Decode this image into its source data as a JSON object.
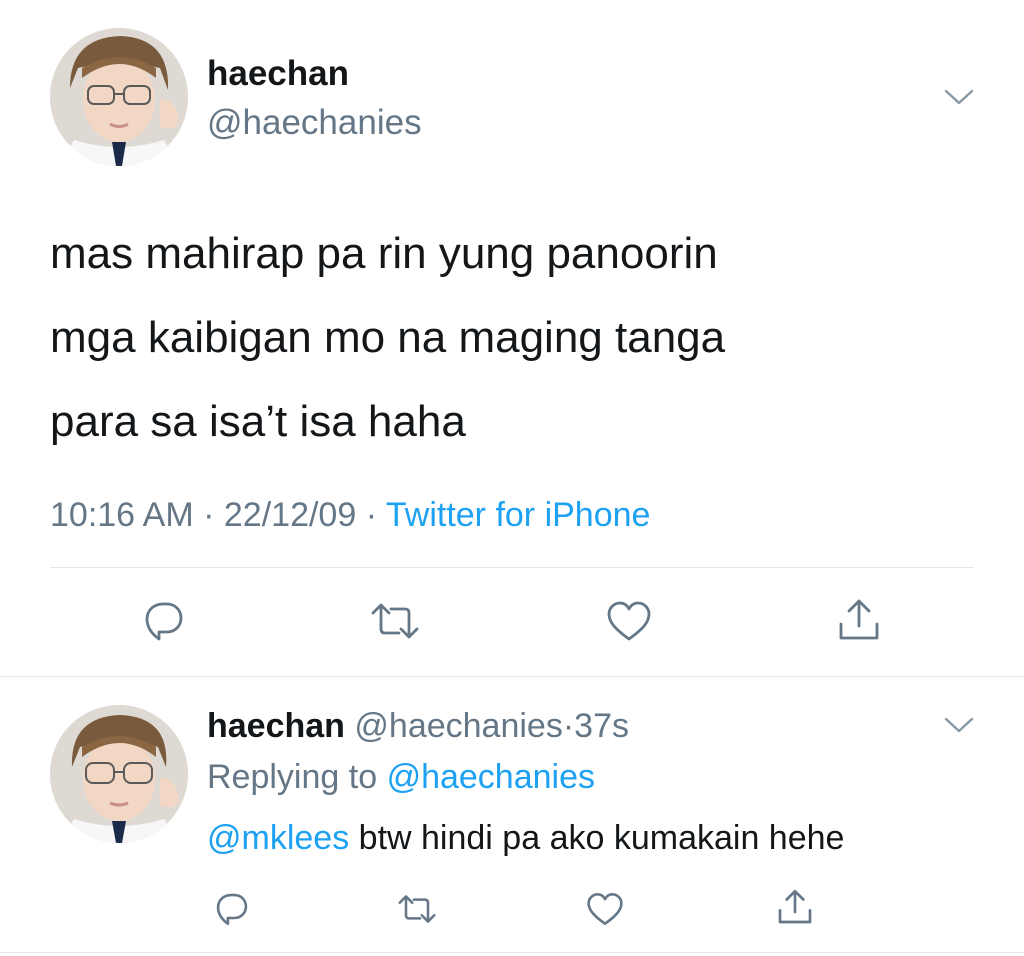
{
  "main_tweet": {
    "name": "haechan",
    "handle": "@haechanies",
    "text_lines": [
      "mas mahirap pa rin yung panoorin",
      "mga kaibigan mo na maging tanga",
      "para sa isa’t isa haha"
    ],
    "time": "10:16 AM",
    "sep1": "·",
    "date": "22/12/09",
    "sep2": "·",
    "source": "Twitter for iPhone",
    "actions": [
      "reply-icon",
      "retweet-icon",
      "like-icon",
      "share-icon"
    ]
  },
  "reply_tweet": {
    "name": "haechan",
    "handle": "@haechanies",
    "sep": "·",
    "age": "37s",
    "replying_label": "Replying to",
    "replying_to": "@haechanies",
    "mention": "@mklees",
    "text": "btw hindi pa ako kumakain hehe",
    "actions": [
      "reply-icon",
      "retweet-icon",
      "like-icon",
      "share-icon"
    ]
  },
  "colors": {
    "text": "#14171a",
    "secondary": "#657786",
    "accent": "#1da1f2",
    "divider": "#e1e8ed"
  }
}
